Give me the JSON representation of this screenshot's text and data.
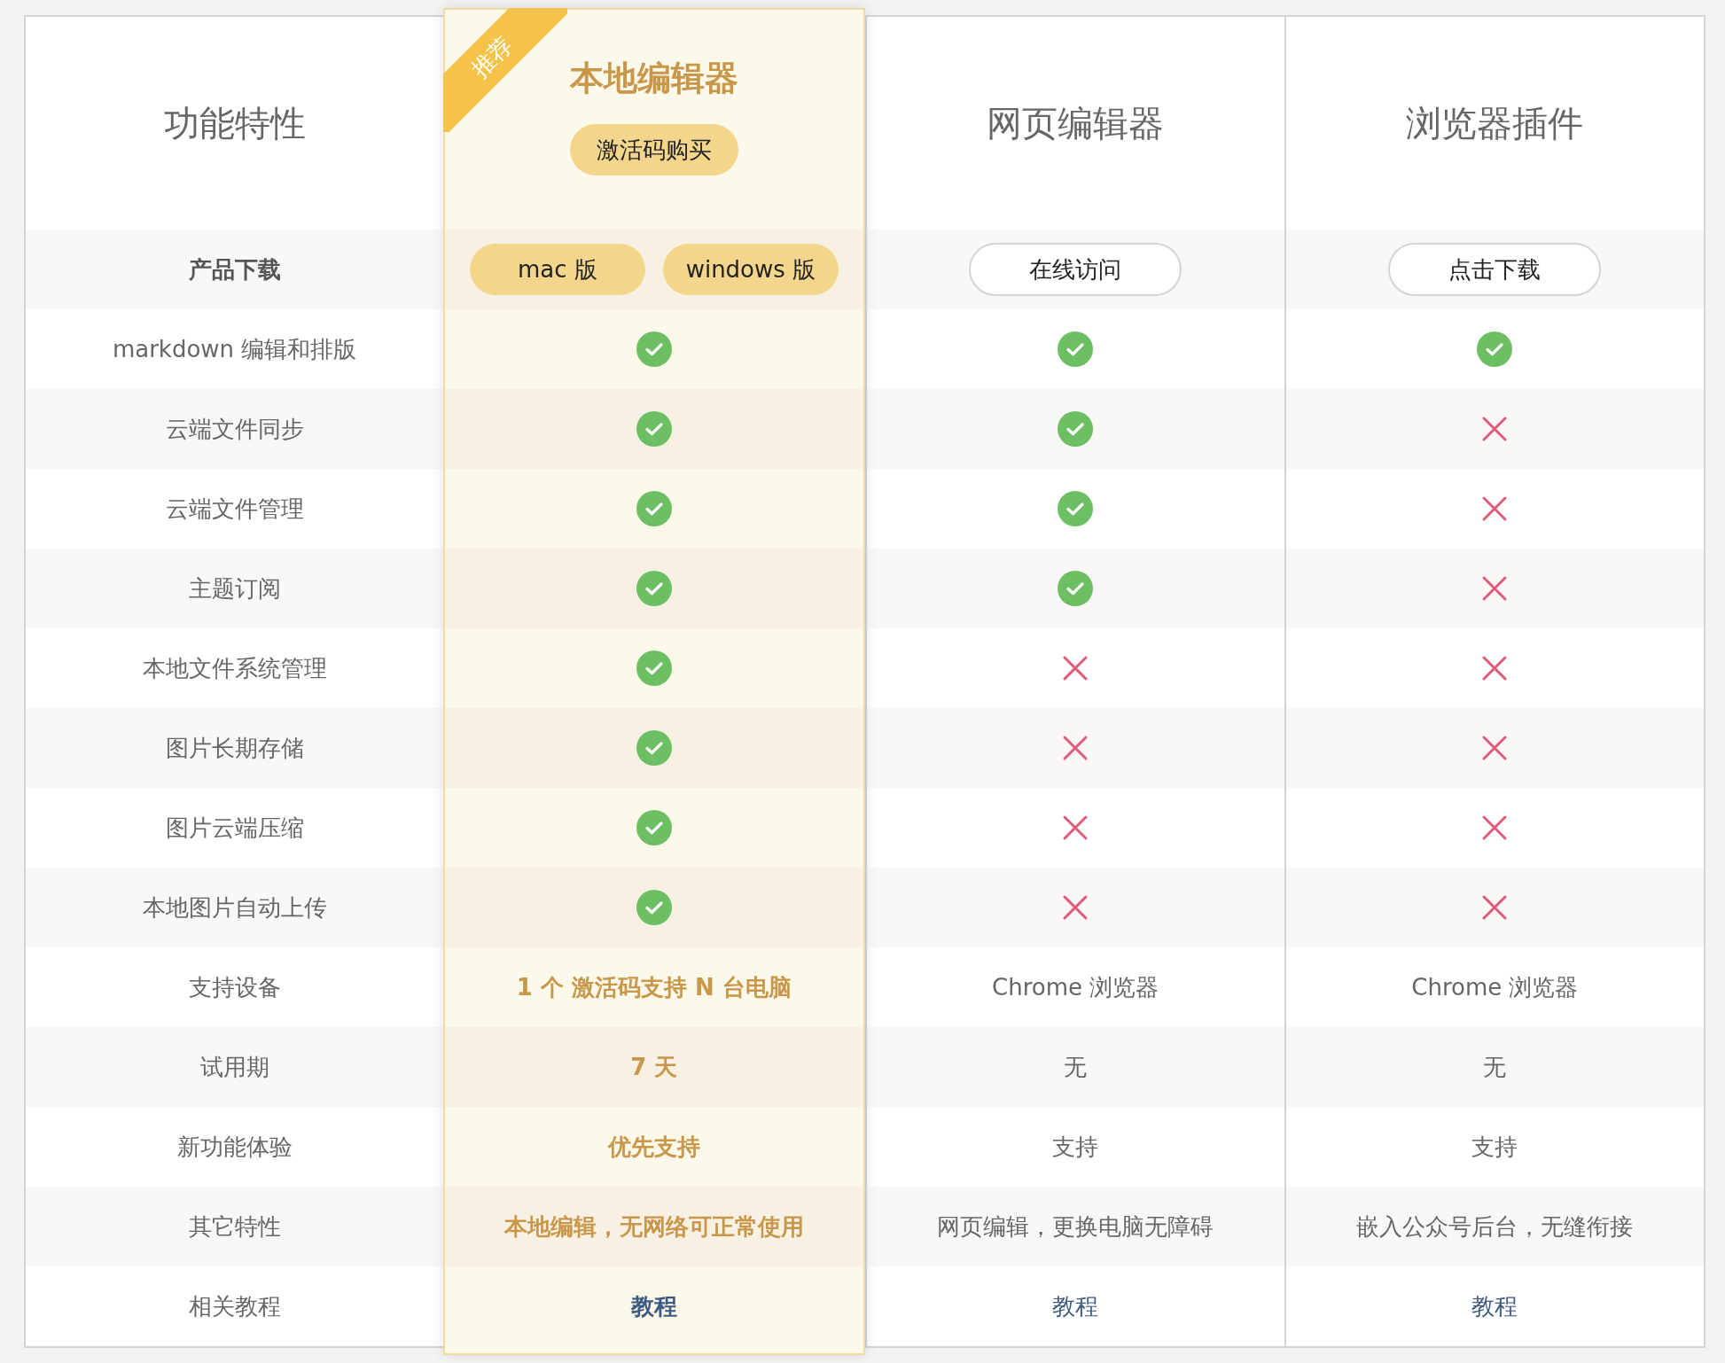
{
  "features": {
    "title": "功能特性",
    "download_label": "产品下载",
    "labels": [
      "markdown 编辑和排版",
      "云端文件同步",
      "云端文件管理",
      "主题订阅",
      "本地文件系统管理",
      "图片长期存储",
      "图片云端压缩",
      "本地图片自动上传",
      "支持设备",
      "试用期",
      "新功能体验",
      "其它特性",
      "相关教程"
    ]
  },
  "products": [
    {
      "title": "本地编辑器",
      "featured": true,
      "ribbon": "推荐",
      "purchase": "激活码购买",
      "downloads": [
        "mac 版",
        "windows 版"
      ],
      "cells": [
        {
          "kind": "check"
        },
        {
          "kind": "check"
        },
        {
          "kind": "check"
        },
        {
          "kind": "check"
        },
        {
          "kind": "check"
        },
        {
          "kind": "check"
        },
        {
          "kind": "check"
        },
        {
          "kind": "check"
        },
        {
          "kind": "text",
          "text": "1 个 激活码支持 N 台电脑"
        },
        {
          "kind": "text",
          "text": "7 天"
        },
        {
          "kind": "text",
          "text": "优先支持"
        },
        {
          "kind": "text",
          "text": "本地编辑，无网络可正常使用"
        },
        {
          "kind": "link",
          "text": "教程"
        }
      ]
    },
    {
      "title": "网页编辑器",
      "featured": false,
      "downloads": [
        "在线访问"
      ],
      "cells": [
        {
          "kind": "check"
        },
        {
          "kind": "check"
        },
        {
          "kind": "check"
        },
        {
          "kind": "check"
        },
        {
          "kind": "cross"
        },
        {
          "kind": "cross"
        },
        {
          "kind": "cross"
        },
        {
          "kind": "cross"
        },
        {
          "kind": "text",
          "text": "Chrome 浏览器"
        },
        {
          "kind": "text",
          "text": "无"
        },
        {
          "kind": "text",
          "text": "支持"
        },
        {
          "kind": "text",
          "text": "网页编辑，更换电脑无障碍"
        },
        {
          "kind": "link",
          "text": "教程"
        }
      ]
    },
    {
      "title": "浏览器插件",
      "featured": false,
      "downloads": [
        "点击下载"
      ],
      "cells": [
        {
          "kind": "check"
        },
        {
          "kind": "cross"
        },
        {
          "kind": "cross"
        },
        {
          "kind": "cross"
        },
        {
          "kind": "cross"
        },
        {
          "kind": "cross"
        },
        {
          "kind": "cross"
        },
        {
          "kind": "cross"
        },
        {
          "kind": "text",
          "text": "Chrome 浏览器"
        },
        {
          "kind": "text",
          "text": "无"
        },
        {
          "kind": "text",
          "text": "支持"
        },
        {
          "kind": "text",
          "text": "嵌入公众号后台，无缝衔接"
        },
        {
          "kind": "link",
          "text": "教程"
        }
      ]
    }
  ]
}
